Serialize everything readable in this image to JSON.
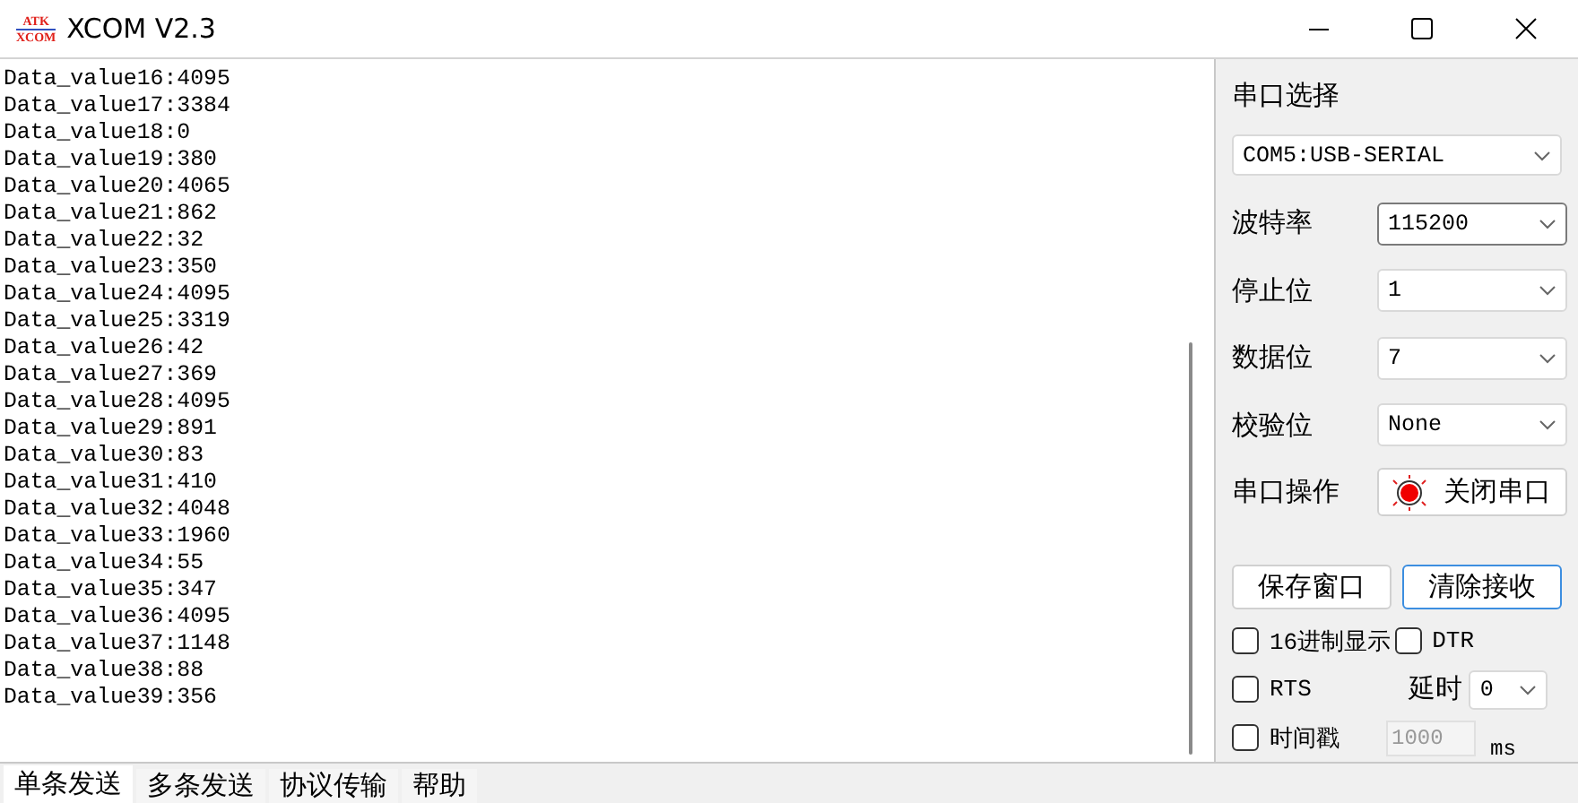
{
  "window": {
    "title": "XCOM V2.3",
    "logo": [
      "ATK",
      "XCOM"
    ]
  },
  "receive_log": [
    "Data_value16:4095",
    "Data_value17:3384",
    "Data_value18:0",
    "Data_value19:380",
    "Data_value20:4065",
    "Data_value21:862",
    "Data_value22:32",
    "Data_value23:350",
    "Data_value24:4095",
    "Data_value25:3319",
    "Data_value26:42",
    "Data_value27:369",
    "Data_value28:4095",
    "Data_value29:891",
    "Data_value30:83",
    "Data_value31:410",
    "Data_value32:4048",
    "Data_value33:1960",
    "Data_value34:55",
    "Data_value35:347",
    "Data_value36:4095",
    "Data_value37:1148",
    "Data_value38:88",
    "Data_value39:356"
  ],
  "port_select": {
    "label": "串口选择",
    "value": "COM5:USB-SERIAL"
  },
  "settings": [
    {
      "label": "波特率",
      "value": "115200",
      "focused": true
    },
    {
      "label": "停止位",
      "value": "1",
      "focused": false
    },
    {
      "label": "数据位",
      "value": "7",
      "focused": false
    },
    {
      "label": "校验位",
      "value": "None",
      "focused": false
    }
  ],
  "port_operation": {
    "label": "串口操作",
    "button": "关闭串口",
    "led_on": true
  },
  "actions": [
    {
      "label": "保存窗口",
      "focused": false
    },
    {
      "label": "清除接收",
      "focused": true
    }
  ],
  "options": {
    "hex_display": {
      "label": "16进制显示",
      "checked": false
    },
    "dtr": {
      "label": "DTR",
      "checked": false
    },
    "rts": {
      "label": "RTS",
      "checked": false
    },
    "delay": {
      "label": "延时",
      "value": "0"
    },
    "timestamp": {
      "label": "时间戳",
      "checked": false
    },
    "interval": {
      "value": "1000",
      "unit": "ms",
      "disabled": true
    }
  },
  "tabs": [
    {
      "label": "单条发送",
      "selected": true
    },
    {
      "label": "多条发送",
      "selected": false
    },
    {
      "label": "协议传输",
      "selected": false
    },
    {
      "label": "帮助",
      "selected": false
    }
  ]
}
